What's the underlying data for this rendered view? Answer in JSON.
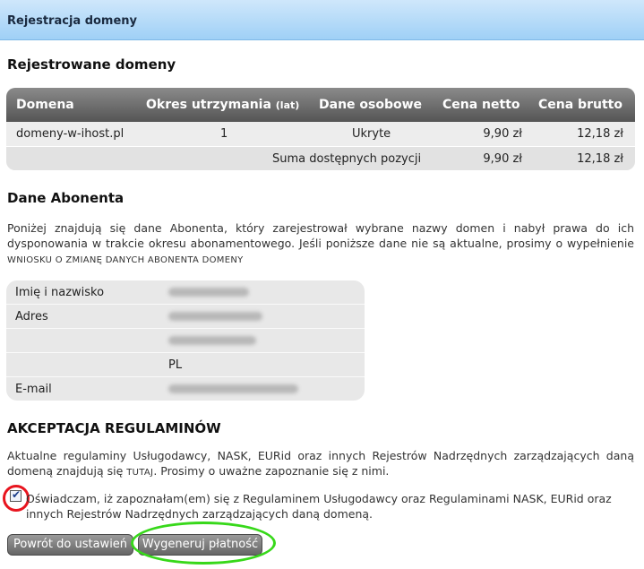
{
  "header": {
    "title": "Rejestracja domeny"
  },
  "domains_section": {
    "title": "Rejestrowane domeny",
    "columns": {
      "domain": "Domena",
      "period": "Okres utrzymania",
      "period_unit": "(lat)",
      "personal": "Dane osobowe",
      "net": "Cena netto",
      "gross": "Cena brutto"
    },
    "rows": [
      {
        "domain": "domeny-w-ihost.pl",
        "period": "1",
        "personal": "Ukryte",
        "net": "9,90 zł",
        "gross": "12,18 zł"
      }
    ],
    "summary": {
      "label": "Suma dostępnych pozycji",
      "net": "9,90 zł",
      "gross": "12,18 zł"
    }
  },
  "subscriber_section": {
    "title": "Dane Abonenta",
    "description": "Poniżej znajdują się dane Abonenta, który zarejestrował wybrane nazwy domen i nabył prawa do ich dysponowania w trakcie okresu abonamentowego. Jeśli poniższe dane nie są aktualne, prosimy o wypełnienie",
    "link": "WNIOSKU O ZMIANĘ DANYCH ABONENTA DOMENY",
    "rows": {
      "name_label": "Imię i nazwisko",
      "address_label": "Adres",
      "country": "PL",
      "email_label": "E-mail"
    }
  },
  "terms_section": {
    "title": "AKCEPTACJA REGULAMINÓW",
    "text_before": "Aktualne regulaminy Usługodawcy, NASK, EURid oraz innych Rejestrów Nadrzędnych zarządzających daną domeną znajdują się",
    "link": "TUTAJ",
    "text_after": ". Prosimy o uważne zapoznanie się z nimi.",
    "consent": "Oświadczam, iż zapoznałam(em) się z Regulaminem Usługodawcy oraz Regulaminami NASK, EURid oraz innych Rejestrów Nadrzędnych zarządzających daną domeną."
  },
  "buttons": {
    "back": "Powrót do ustawień",
    "generate": "Wygeneruj płatność"
  },
  "colors": {
    "header_bg": "#9fd0f6",
    "highlight_red": "#e8141e",
    "highlight_green": "#37d81a"
  }
}
